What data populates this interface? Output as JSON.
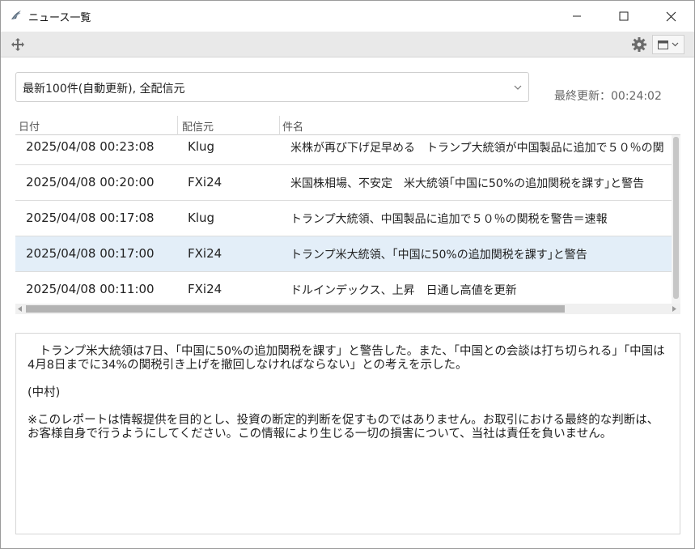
{
  "window": {
    "title": "ニュース一覧"
  },
  "filter": {
    "selected": "最新100件(自動更新), 全配信元"
  },
  "status": {
    "last_updated": "最終更新：00:24:02"
  },
  "table": {
    "columns": [
      "日付",
      "配信元",
      "件名"
    ],
    "rows": [
      {
        "date": "2025/04/08 00:23:08",
        "source": "Klug",
        "subject": "米株が再び下げ足早める　トランプ大統領が中国製品に追加で５０％の関"
      },
      {
        "date": "2025/04/08 00:20:00",
        "source": "FXi24",
        "subject": "米国株相場、不安定　米大統領｢中国に50%の追加関税を課す｣と警告"
      },
      {
        "date": "2025/04/08 00:17:08",
        "source": "Klug",
        "subject": "トランプ大統領、中国製品に追加で５０％の関税を警告＝速報"
      },
      {
        "date": "2025/04/08 00:17:00",
        "source": "FXi24",
        "subject": "トランプ米大統領、｢中国に50%の追加関税を課す｣と警告"
      },
      {
        "date": "2025/04/08 00:11:00",
        "source": "FXi24",
        "subject": "ドルインデックス、上昇　日通し高値を更新"
      }
    ],
    "selected_index": 3
  },
  "article": {
    "paragraphs": [
      "　トランプ米大統領は7日、「中国に50%の追加関税を課す」と警告した。また、「中国との会談は打ち切られる」「中国は4月8日までに34%の関税引き上げを撤回しなければならない」との考えを示した。",
      "(中村)",
      "※このレポートは情報提供を目的とし、投資の断定的判断を促すものではありません。お取引における最終的な判断は、お客様自身で行うようにしてください。この情報により生じる一切の損害について、当社は責任を負いません。"
    ]
  },
  "colors": {
    "toolbar_bg": "#e9e9e9",
    "selected_row": "#e3eef8",
    "scroll_thumb": "#b3b3b3"
  }
}
